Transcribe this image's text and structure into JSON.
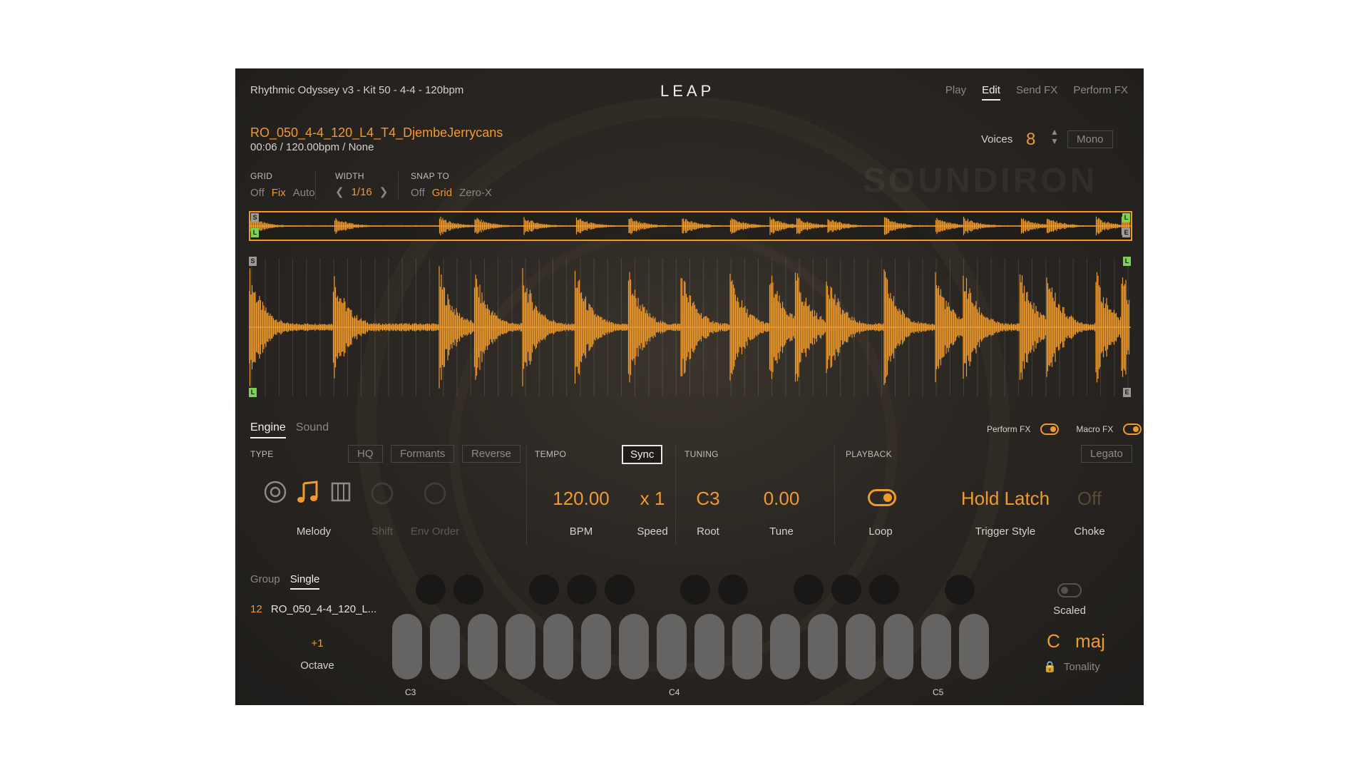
{
  "header": {
    "preset_title": "Rhythmic Odyssey v3 - Kit 50 - 4-4 - 120bpm",
    "logo": "LEAP",
    "nav": [
      "Play",
      "Edit",
      "Send FX",
      "Perform FX"
    ],
    "nav_active": "Edit"
  },
  "sample": {
    "name": "RO_050_4-4_120_L4_T4_DjembeJerrycans",
    "info": "00:06 / 120.00bpm / None"
  },
  "voices": {
    "label": "Voices",
    "value": "8",
    "mono_label": "Mono"
  },
  "watermark": "SOUNDIRON",
  "grid": {
    "label": "GRID",
    "options": [
      "Off",
      "Fix",
      "Auto"
    ],
    "selected": "Fix"
  },
  "width": {
    "label": "WIDTH",
    "value": "1/16"
  },
  "snap": {
    "label": "SNAP TO",
    "options": [
      "Off",
      "Grid",
      "Zero-X"
    ],
    "selected": "Grid"
  },
  "markers": {
    "start": "S",
    "loop": "L",
    "end": "E"
  },
  "lower_tabs": [
    "Engine",
    "Sound"
  ],
  "lower_tab_active": "Engine",
  "fx_toggles": {
    "perform_fx": "Perform FX",
    "macro_fx": "Macro FX"
  },
  "type": {
    "label": "TYPE",
    "buttons": [
      "HQ",
      "Formants",
      "Reverse"
    ],
    "mode_label": "Melody",
    "shift_label": "Shift",
    "env_order_label": "Env Order"
  },
  "tempo": {
    "label": "TEMPO",
    "sync_label": "Sync",
    "bpm_value": "120.00",
    "bpm_label": "BPM",
    "speed_value": "x 1",
    "speed_label": "Speed"
  },
  "tuning": {
    "label": "TUNING",
    "root_value": "C3",
    "root_label": "Root",
    "tune_value": "0.00",
    "tune_label": "Tune"
  },
  "playback": {
    "label": "PLAYBACK",
    "legato_label": "Legato",
    "loop_label": "Loop",
    "trigger_value": "Hold Latch",
    "trigger_label": "Trigger Style",
    "choke_value": "Off",
    "choke_label": "Choke"
  },
  "mapping": {
    "tabs": [
      "Group",
      "Single"
    ],
    "active_tab": "Single",
    "slice_index": "12",
    "slice_name": "RO_050_4-4_120_L...",
    "octave_value": "+1",
    "octave_label": "Octave"
  },
  "keyboard": {
    "labels": [
      "C3",
      "C4",
      "C5"
    ]
  },
  "scale": {
    "scaled_label": "Scaled",
    "key": "C",
    "mode": "maj",
    "tonality_label": "Tonality"
  },
  "colors": {
    "accent": "#f09a2a",
    "loop_marker": "#7bd44f"
  }
}
